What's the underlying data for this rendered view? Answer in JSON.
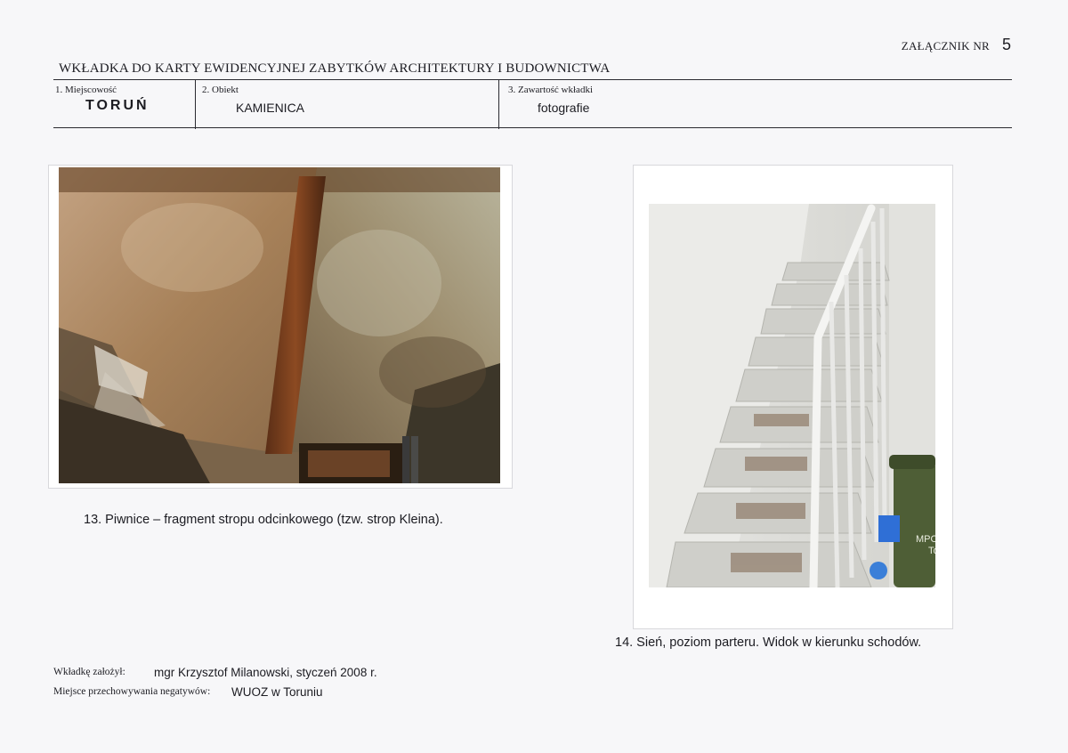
{
  "header": {
    "annex_label": "ZAŁĄCZNIK NR",
    "annex_number": "5",
    "title": "WKŁADKA DO KARTY EWIDENCYJNEJ ZABYTKÓW ARCHITEKTURY I BUDOWNICTWA"
  },
  "fields": [
    {
      "label": "1. Miejscowość",
      "value": "TORUŃ"
    },
    {
      "label": "2. Obiekt",
      "value": "KAMIENICA"
    },
    {
      "label": "3. Zawartość wkładki",
      "value": "fotografie"
    }
  ],
  "photos": [
    {
      "caption": "13. Piwnice – fragment stropu odcinkowego (tzw. strop Kleina)."
    },
    {
      "caption": "14. Sień, poziom parteru. Widok w kierunku schodów.",
      "bin_label_1": "MPO",
      "bin_label_2": "To"
    }
  ],
  "footer": {
    "author_label": "Wkładkę założył:",
    "author_value": "mgr Krzysztof Milanowski, styczeń 2008 r.",
    "storage_label": "Miejsce przechowywania negatywów:",
    "storage_value": "WUOZ w Toruniu"
  }
}
